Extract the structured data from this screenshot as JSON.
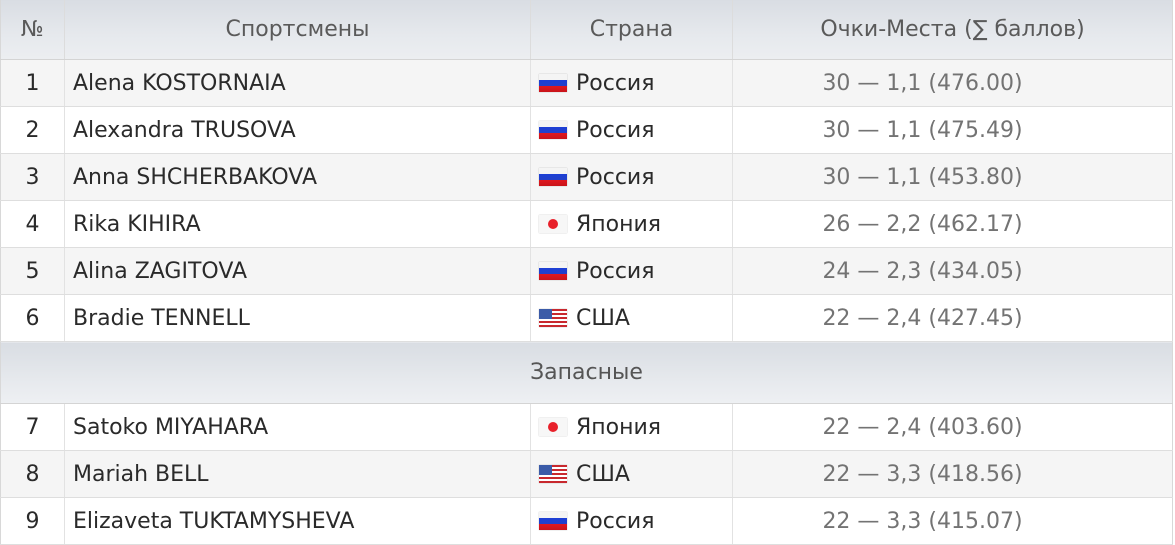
{
  "header": {
    "num": "№",
    "athletes": "Спортсмены",
    "country": "Страна",
    "score": "Очки-Места (∑ баллов)"
  },
  "icons": {
    "Россия": "flag-russia-icon",
    "Япония": "flag-japan-icon",
    "США": "flag-usa-icon"
  },
  "main_rows": [
    {
      "num": "1",
      "name": "Alena KOSTORNAIA",
      "flag": "ru",
      "country": "Россия",
      "score": "30 — 1,1 (476.00)"
    },
    {
      "num": "2",
      "name": "Alexandra TRUSOVA",
      "flag": "ru",
      "country": "Россия",
      "score": "30 — 1,1 (475.49)"
    },
    {
      "num": "3",
      "name": "Anna SHCHERBAKOVA",
      "flag": "ru",
      "country": "Россия",
      "score": "30 — 1,1 (453.80)"
    },
    {
      "num": "4",
      "name": "Rika KIHIRA",
      "flag": "jp",
      "country": "Япония",
      "score": "26 — 2,2 (462.17)"
    },
    {
      "num": "5",
      "name": "Alina ZAGITOVA",
      "flag": "ru",
      "country": "Россия",
      "score": "24 — 2,3 (434.05)"
    },
    {
      "num": "6",
      "name": "Bradie TENNELL",
      "flag": "us",
      "country": "США",
      "score": "22 — 2,4 (427.45)"
    }
  ],
  "reserves": {
    "title": "Запасные",
    "rows": [
      {
        "num": "7",
        "name": "Satoko MIYAHARA",
        "flag": "jp",
        "country": "Япония",
        "score": "22 — 2,4 (403.60)"
      },
      {
        "num": "8",
        "name": "Mariah BELL",
        "flag": "us",
        "country": "США",
        "score": "22 — 3,3 (418.56)"
      },
      {
        "num": "9",
        "name": "Elizaveta TUKTAMYSHEVA",
        "flag": "ru",
        "country": "Россия",
        "score": "22 — 3,3 (415.07)"
      }
    ]
  }
}
